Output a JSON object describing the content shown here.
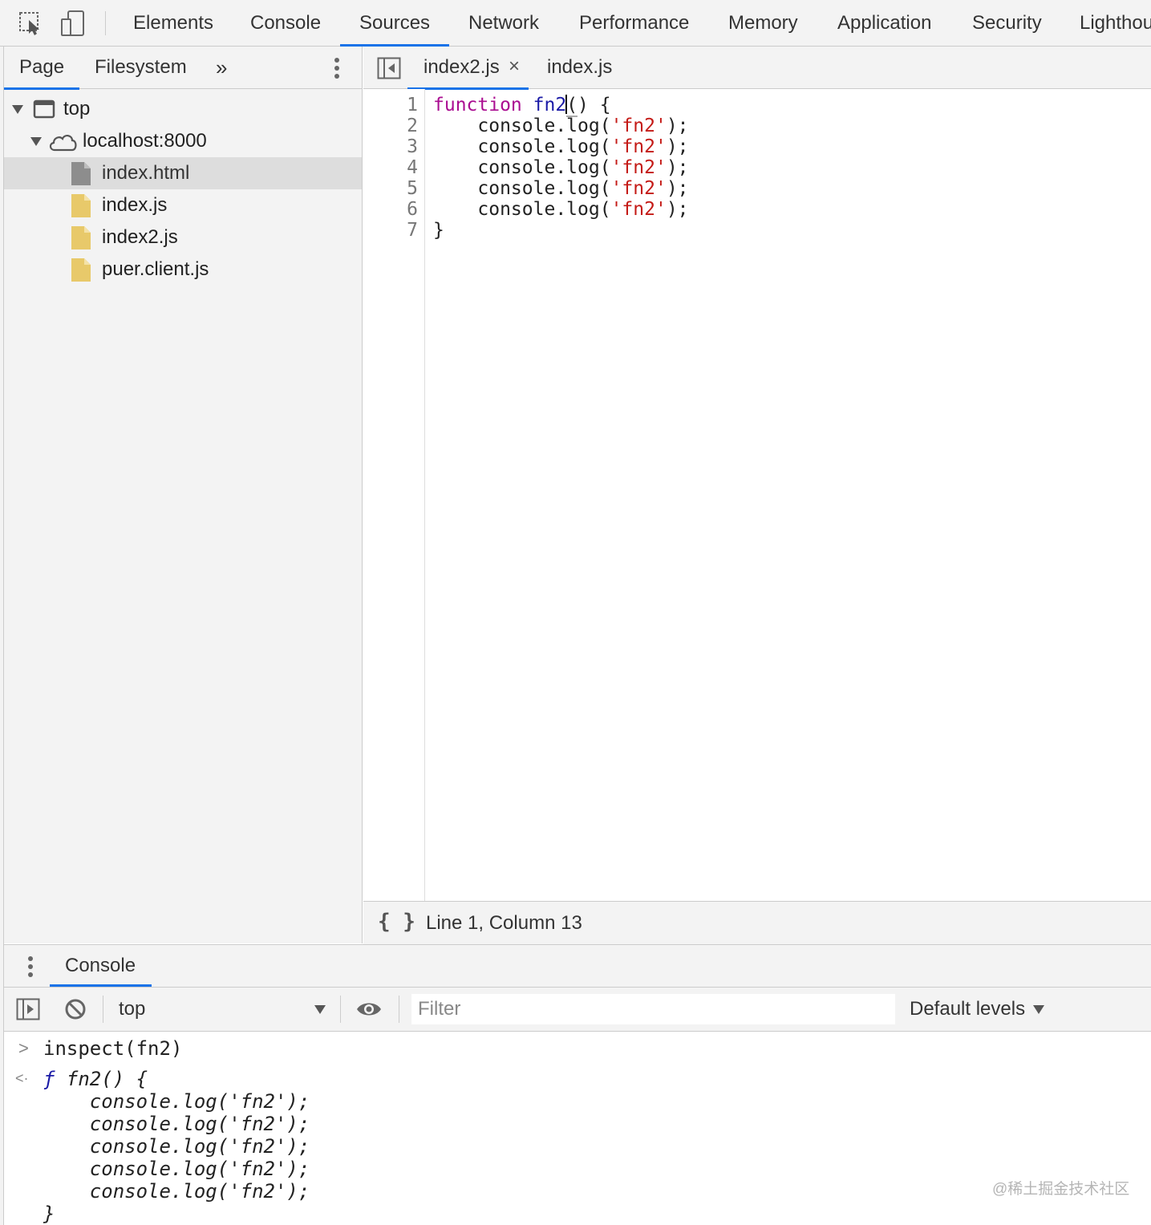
{
  "main_tabs": [
    "Elements",
    "Console",
    "Sources",
    "Network",
    "Performance",
    "Memory",
    "Application",
    "Security",
    "Lighthou"
  ],
  "active_main_tab": "Sources",
  "navigator": {
    "tabs": [
      "Page",
      "Filesystem"
    ],
    "more": "»",
    "tree": {
      "top": "top",
      "origin": "localhost:8000",
      "files": [
        "index.html",
        "index.js",
        "index2.js",
        "puer.client.js"
      ]
    }
  },
  "editor": {
    "tabs": [
      "index2.js",
      "index.js"
    ],
    "close": "×",
    "line_numbers": [
      "1",
      "2",
      "3",
      "4",
      "5",
      "6",
      "7"
    ],
    "code": {
      "keyword": "function",
      "name": "fn2",
      "open_paren": "(",
      "close_rest": ") {",
      "indent": "    ",
      "call": "console.log(",
      "string": "'fn2'",
      "call_end": ");",
      "close": "}"
    },
    "status": {
      "format_icon": "{ }",
      "position": "Line 1, Column 13"
    }
  },
  "drawer": {
    "tab": "Console",
    "context": "top",
    "filter_placeholder": "Filter",
    "levels": "Default levels",
    "input_prompt": ">",
    "output_prompt": "<·",
    "input": "inspect(fn2)",
    "output": {
      "head_f": "ƒ",
      "head_rest": " fn2() {",
      "line": "    console.log('fn2');",
      "close": "}"
    }
  },
  "watermark": "@稀土掘金技术社区",
  "colors": {
    "accent": "#1a73e8",
    "keyword": "#aa0d91",
    "string": "#c41a16",
    "function_name": "#1a1aa6"
  }
}
